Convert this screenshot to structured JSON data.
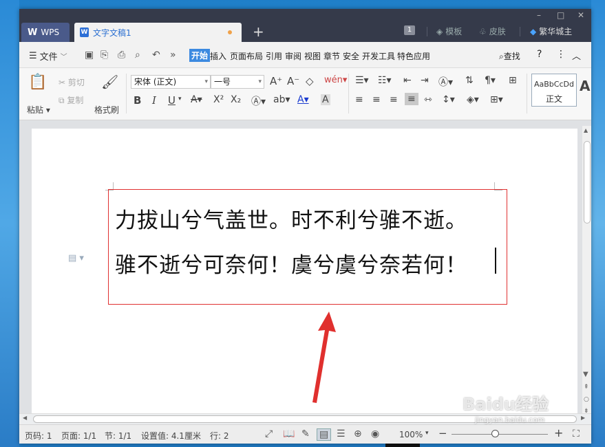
{
  "titlebar": {
    "app_tab": "WPS",
    "doc_tab": "文字文稿1",
    "doc_icon_letter": "W",
    "new_tab": "+",
    "win_badge": "1",
    "template": "模板",
    "skin": "皮肤",
    "account": "繁华城主",
    "minimize": "–",
    "maximize": "□",
    "close": "✕"
  },
  "menubar": {
    "file": "文件",
    "items": [
      "开始",
      "插入",
      "页面布局",
      "引用",
      "审阅",
      "视图",
      "章节",
      "安全",
      "开发工具",
      "特色应用"
    ],
    "search": "查找",
    "help": "?",
    "more": "⋮",
    "collapse": "︿"
  },
  "ribbon": {
    "paste": "粘贴",
    "cut": "剪切",
    "copy": "复制",
    "format_painter": "格式刷",
    "font_name": "宋体 (正文)",
    "font_size": "一号",
    "bold": "B",
    "italic": "I",
    "underline": "U",
    "style_sample": "AaBbCcDd",
    "style_name": "正文"
  },
  "document": {
    "line1": "力拔山兮气盖世。时不利兮骓不逝。",
    "line2": "骓不逝兮可奈何！虞兮虞兮奈若何！"
  },
  "statusbar": {
    "page_num": "页码: 1",
    "page_count": "页面: 1/1",
    "section": "节: 1/1",
    "setting": "设置值: 4.1厘米",
    "row": "行: 2",
    "zoom": "100%",
    "zoom_level": 0.46,
    "zoom_minus": "−",
    "zoom_plus": "+"
  },
  "watermark": {
    "text": "Baidu经验",
    "url": "jingyan.baidu.com"
  },
  "colors": {
    "titlebar": "#353a4a",
    "accent": "#3c8ae0",
    "textbox_border": "#e03030"
  }
}
